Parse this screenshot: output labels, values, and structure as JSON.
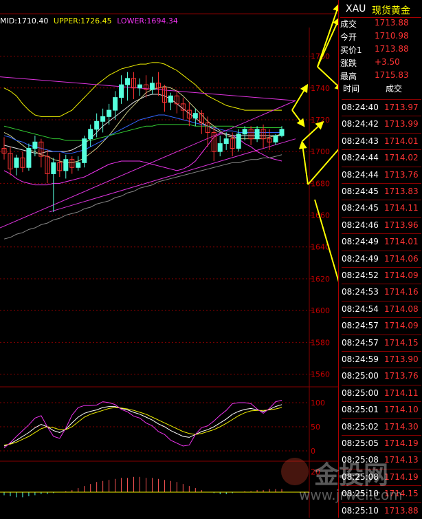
{
  "legend": {
    "mid": "MID:1710.40",
    "upper": "UPPER:1726.45",
    "lower": "LOWER:1694.34"
  },
  "quote": {
    "symbol": "XAU",
    "name": "现货黄金",
    "rows": [
      {
        "label": "成交",
        "value": "1713.88"
      },
      {
        "label": "今开",
        "value": "1710.98"
      },
      {
        "label": "买价1",
        "value": "1713.88"
      },
      {
        "label": "涨跌",
        "value": "+3.50"
      },
      {
        "label": "最高",
        "value": "1715.83"
      }
    ]
  },
  "ticks_header": {
    "time": "时间",
    "price": "成交"
  },
  "ticks": [
    {
      "time": "08:24:40",
      "price": "1713.97"
    },
    {
      "time": "08:24:42",
      "price": "1713.99"
    },
    {
      "time": "08:24:43",
      "price": "1714.01"
    },
    {
      "time": "08:24:44",
      "price": "1714.02"
    },
    {
      "time": "08:24:44",
      "price": "1713.76"
    },
    {
      "time": "08:24:45",
      "price": "1713.83"
    },
    {
      "time": "08:24:45",
      "price": "1714.11"
    },
    {
      "time": "08:24:46",
      "price": "1713.96"
    },
    {
      "time": "08:24:49",
      "price": "1714.01"
    },
    {
      "time": "08:24:49",
      "price": "1714.06"
    },
    {
      "time": "08:24:52",
      "price": "1714.09"
    },
    {
      "time": "08:24:53",
      "price": "1714.16"
    },
    {
      "time": "08:24:54",
      "price": "1714.08"
    },
    {
      "time": "08:24:57",
      "price": "1714.09"
    },
    {
      "time": "08:24:57",
      "price": "1714.15"
    },
    {
      "time": "08:24:59",
      "price": "1713.90"
    },
    {
      "time": "08:25:00",
      "price": "1713.76"
    },
    {
      "time": "08:25:00",
      "price": "1714.11"
    },
    {
      "time": "08:25:01",
      "price": "1714.10"
    },
    {
      "time": "08:25:02",
      "price": "1714.30"
    },
    {
      "time": "08:25:05",
      "price": "1714.19"
    },
    {
      "time": "08:25:08",
      "price": "1714.13"
    },
    {
      "time": "08:25:08",
      "price": "1714.19"
    },
    {
      "time": "08:25:10",
      "price": "1714.15"
    },
    {
      "time": "08:25:10",
      "price": "1713.88"
    }
  ],
  "watermark": {
    "brand": "金投网",
    "url": "www.jrwei.com"
  },
  "colors": {
    "up": "#5fd",
    "down": "#f33",
    "upper": "#ee0",
    "lower": "#e3e",
    "mid": "#fff",
    "grid": "#800",
    "annot": "#ff0"
  },
  "chart_data": [
    {
      "type": "candlestick",
      "panel": "main",
      "title": "",
      "ylim": [
        1552,
        1778
      ],
      "yticks": [
        1560,
        1580,
        1600,
        1620,
        1640,
        1660,
        1680,
        1700,
        1720,
        1740,
        1760
      ],
      "candles": [
        {
          "o": 1702,
          "h": 1709,
          "c": 1699,
          "l": 1695
        },
        {
          "o": 1699,
          "h": 1703,
          "c": 1689,
          "l": 1685
        },
        {
          "o": 1690,
          "h": 1698,
          "c": 1696,
          "l": 1685
        },
        {
          "o": 1696,
          "h": 1700,
          "c": 1690,
          "l": 1687
        },
        {
          "o": 1690,
          "h": 1705,
          "c": 1702,
          "l": 1688
        },
        {
          "o": 1702,
          "h": 1710,
          "c": 1706,
          "l": 1697
        },
        {
          "o": 1706,
          "h": 1708,
          "c": 1697,
          "l": 1690
        },
        {
          "o": 1697,
          "h": 1701,
          "c": 1686,
          "l": 1680
        },
        {
          "o": 1686,
          "h": 1696,
          "c": 1693,
          "l": 1662
        },
        {
          "o": 1693,
          "h": 1699,
          "c": 1688,
          "l": 1684
        },
        {
          "o": 1688,
          "h": 1698,
          "c": 1695,
          "l": 1683
        },
        {
          "o": 1695,
          "h": 1697,
          "c": 1690,
          "l": 1686
        },
        {
          "o": 1690,
          "h": 1697,
          "c": 1693,
          "l": 1688
        },
        {
          "o": 1693,
          "h": 1710,
          "c": 1708,
          "l": 1690
        },
        {
          "o": 1708,
          "h": 1717,
          "c": 1714,
          "l": 1703
        },
        {
          "o": 1714,
          "h": 1724,
          "c": 1719,
          "l": 1709
        },
        {
          "o": 1719,
          "h": 1727,
          "c": 1722,
          "l": 1712
        },
        {
          "o": 1722,
          "h": 1730,
          "c": 1726,
          "l": 1717
        },
        {
          "o": 1726,
          "h": 1738,
          "c": 1734,
          "l": 1720
        },
        {
          "o": 1734,
          "h": 1748,
          "c": 1742,
          "l": 1730
        },
        {
          "o": 1742,
          "h": 1750,
          "c": 1746,
          "l": 1732
        },
        {
          "o": 1746,
          "h": 1750,
          "c": 1740,
          "l": 1733
        },
        {
          "o": 1740,
          "h": 1746,
          "c": 1742,
          "l": 1735
        },
        {
          "o": 1742,
          "h": 1748,
          "c": 1739,
          "l": 1734
        },
        {
          "o": 1739,
          "h": 1747,
          "c": 1743,
          "l": 1736
        },
        {
          "o": 1743,
          "h": 1750,
          "c": 1740,
          "l": 1735
        },
        {
          "o": 1740,
          "h": 1742,
          "c": 1731,
          "l": 1725
        },
        {
          "o": 1731,
          "h": 1737,
          "c": 1735,
          "l": 1726
        },
        {
          "o": 1735,
          "h": 1739,
          "c": 1730,
          "l": 1724
        },
        {
          "o": 1730,
          "h": 1734,
          "c": 1726,
          "l": 1720
        },
        {
          "o": 1726,
          "h": 1731,
          "c": 1721,
          "l": 1716
        },
        {
          "o": 1721,
          "h": 1727,
          "c": 1724,
          "l": 1716
        },
        {
          "o": 1724,
          "h": 1726,
          "c": 1718,
          "l": 1711
        },
        {
          "o": 1718,
          "h": 1722,
          "c": 1712,
          "l": 1703
        },
        {
          "o": 1712,
          "h": 1716,
          "c": 1700,
          "l": 1694
        },
        {
          "o": 1700,
          "h": 1710,
          "c": 1705,
          "l": 1697
        },
        {
          "o": 1705,
          "h": 1712,
          "c": 1708,
          "l": 1701
        },
        {
          "o": 1708,
          "h": 1712,
          "c": 1702,
          "l": 1697
        },
        {
          "o": 1702,
          "h": 1714,
          "c": 1711,
          "l": 1700
        },
        {
          "o": 1711,
          "h": 1716,
          "c": 1714,
          "l": 1707
        },
        {
          "o": 1714,
          "h": 1716,
          "c": 1708,
          "l": 1704
        },
        {
          "o": 1708,
          "h": 1716,
          "c": 1714,
          "l": 1706
        },
        {
          "o": 1714,
          "h": 1717,
          "c": 1708,
          "l": 1702
        },
        {
          "o": 1708,
          "h": 1714,
          "c": 1706,
          "l": 1701
        },
        {
          "o": 1706,
          "h": 1711,
          "c": 1710,
          "l": 1704
        },
        {
          "o": 1710,
          "h": 1716,
          "c": 1714,
          "l": 1709
        }
      ],
      "lines": [
        {
          "name": "upper",
          "values": [
            1740,
            1738,
            1735,
            1730,
            1726,
            1723,
            1722,
            1722,
            1722,
            1722,
            1724,
            1726,
            1730,
            1734,
            1738,
            1742,
            1745,
            1748,
            1750,
            1752,
            1753,
            1754,
            1755,
            1755,
            1756,
            1756,
            1755,
            1753,
            1751,
            1748,
            1745,
            1742,
            1738,
            1735,
            1733,
            1731,
            1729,
            1728,
            1727,
            1726,
            1726,
            1726,
            1726,
            1726,
            1726,
            1726
          ]
        },
        {
          "name": "lower",
          "values": [
            1688,
            1686,
            1683,
            1681,
            1680,
            1679,
            1679,
            1679,
            1680,
            1680,
            1681,
            1682,
            1683,
            1684,
            1686,
            1688,
            1690,
            1692,
            1693,
            1694,
            1694,
            1694,
            1694,
            1693,
            1692,
            1691,
            1690,
            1689,
            1688,
            1689,
            1691,
            1694,
            1699,
            1704,
            1709,
            1711,
            1711,
            1710,
            1708,
            1705,
            1703,
            1700,
            1698,
            1696,
            1695,
            1694
          ]
        },
        {
          "name": "mid",
          "values": [
            1704,
            1703,
            1702,
            1701,
            1700,
            1699,
            1699,
            1700,
            1700,
            1700,
            1700,
            1701,
            1703,
            1705,
            1708,
            1712,
            1716,
            1719,
            1722,
            1725,
            1728,
            1731,
            1733,
            1735,
            1736,
            1736,
            1735,
            1733,
            1730,
            1727,
            1724,
            1721,
            1718,
            1716,
            1714,
            1712,
            1711,
            1710,
            1710,
            1710,
            1710,
            1710,
            1710,
            1710,
            1710,
            1710
          ]
        },
        {
          "name": "ma-yellow",
          "values": [
            1712,
            1710,
            1707,
            1704,
            1701,
            1700,
            1698,
            1697,
            1695,
            1694,
            1693,
            1693,
            1694,
            1696,
            1699,
            1702,
            1706,
            1710,
            1715,
            1720,
            1725,
            1729,
            1733,
            1737,
            1739,
            1740,
            1741,
            1740,
            1738,
            1735,
            1731,
            1727,
            1723,
            1719,
            1716,
            1713,
            1710,
            1709,
            1708,
            1708,
            1708,
            1708,
            1708,
            1709,
            1710,
            1711
          ]
        },
        {
          "name": "ma-blue",
          "values": [
            1710,
            1709,
            1707,
            1706,
            1704,
            1703,
            1702,
            1701,
            1700,
            1700,
            1699,
            1699,
            1700,
            1701,
            1703,
            1705,
            1707,
            1710,
            1712,
            1714,
            1716,
            1718,
            1720,
            1721,
            1722,
            1723,
            1723,
            1722,
            1721,
            1720,
            1719,
            1718,
            1717,
            1716,
            1715,
            1714,
            1713,
            1713,
            1712,
            1712,
            1712,
            1712,
            1712,
            1712,
            1712,
            1712
          ]
        },
        {
          "name": "ma-green",
          "values": [
            1716,
            1715,
            1714,
            1713,
            1712,
            1711,
            1710,
            1709,
            1708,
            1708,
            1707,
            1707,
            1707,
            1707,
            1707,
            1708,
            1709,
            1710,
            1711,
            1712,
            1713,
            1714,
            1715,
            1716,
            1716,
            1717,
            1717,
            1717,
            1717,
            1717,
            1717,
            1716,
            1716,
            1716,
            1716,
            1716,
            1716,
            1716,
            1715,
            1715,
            1715,
            1715,
            1715,
            1715,
            1715,
            1715
          ]
        },
        {
          "name": "ma-grey",
          "values": [
            1645,
            1646,
            1648,
            1649,
            1651,
            1652,
            1654,
            1655,
            1657,
            1658,
            1660,
            1661,
            1662,
            1664,
            1665,
            1667,
            1668,
            1669,
            1671,
            1672,
            1674,
            1675,
            1677,
            1678,
            1679,
            1681,
            1682,
            1683,
            1684,
            1685,
            1686,
            1687,
            1688,
            1689,
            1690,
            1691,
            1692,
            1693,
            1693,
            1694,
            1695,
            1695,
            1696,
            1696,
            1697,
            1698
          ]
        }
      ],
      "trendlines": [
        {
          "from": [
            0,
            1747
          ],
          "to": [
            45,
            1732
          ]
        },
        {
          "from": [
            0,
            1652
          ],
          "to": [
            45,
            1732
          ]
        },
        {
          "from": [
            8,
            1662
          ],
          "to": [
            45,
            1708
          ]
        }
      ]
    },
    {
      "type": "line",
      "panel": "oscillator",
      "ylim": [
        0,
        100
      ],
      "yticks": [
        0,
        50,
        100
      ],
      "series": [
        {
          "name": "k",
          "values": [
            10,
            15,
            22,
            30,
            38,
            48,
            55,
            50,
            42,
            38,
            45,
            58,
            70,
            78,
            82,
            85,
            90,
            92,
            92,
            88,
            85,
            80,
            76,
            70,
            64,
            56,
            50,
            42,
            36,
            30,
            28,
            34,
            40,
            44,
            50,
            58,
            66,
            76,
            82,
            86,
            88,
            85,
            82,
            86,
            92,
            96
          ]
        },
        {
          "name": "d",
          "values": [
            12,
            14,
            18,
            24,
            30,
            38,
            46,
            50,
            48,
            44,
            44,
            50,
            60,
            70,
            76,
            80,
            84,
            88,
            90,
            89,
            87,
            84,
            80,
            76,
            70,
            64,
            58,
            52,
            46,
            40,
            36,
            34,
            36,
            40,
            44,
            50,
            57,
            65,
            73,
            79,
            83,
            84,
            84,
            85,
            87,
            90
          ]
        },
        {
          "name": "j",
          "values": [
            6,
            17,
            30,
            42,
            54,
            68,
            73,
            50,
            30,
            26,
            47,
            74,
            90,
            94,
            94,
            95,
            102,
            100,
            96,
            86,
            81,
            72,
            68,
            58,
            52,
            40,
            34,
            22,
            16,
            10,
            12,
            34,
            48,
            52,
            62,
            74,
            84,
            98,
            100,
            100,
            98,
            87,
            78,
            88,
            102,
            108
          ]
        }
      ]
    },
    {
      "type": "bar",
      "panel": "macd",
      "ylim": [
        -25,
        25
      ],
      "yticks": [
        20
      ],
      "values": [
        -3,
        -4,
        -5,
        -5,
        -4,
        -3,
        -2,
        -2,
        -1,
        0,
        1,
        2,
        4,
        6,
        8,
        10,
        11,
        12,
        13,
        14,
        14,
        15,
        15,
        14,
        14,
        13,
        12,
        11,
        10,
        8,
        6,
        4,
        2,
        0,
        -1,
        -2,
        -2,
        -1,
        0,
        1,
        1,
        2,
        2,
        3,
        3,
        3
      ]
    }
  ]
}
